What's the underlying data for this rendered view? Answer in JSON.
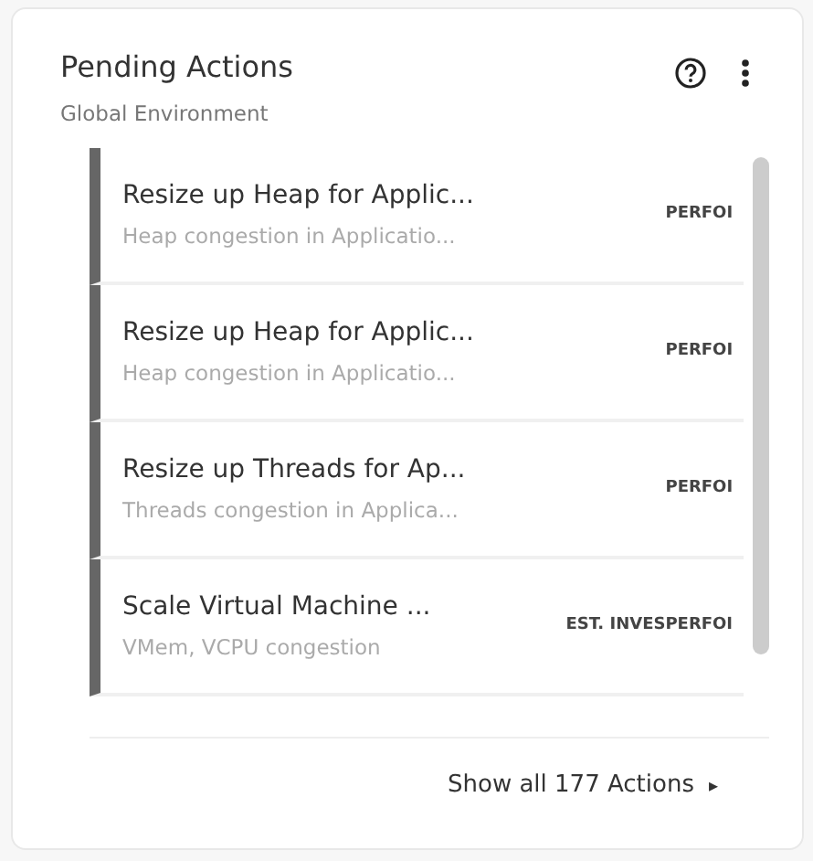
{
  "widget": {
    "title": "Pending Actions",
    "subtitle": "Global Environment"
  },
  "actions": [
    {
      "title": "Resize up Heap for Applic...",
      "detail": "Heap congestion in Applicatio...",
      "tag": "PERFOI"
    },
    {
      "title": "Resize up Heap for Applic...",
      "detail": "Heap congestion in Applicatio...",
      "tag": "PERFOI"
    },
    {
      "title": "Resize up Threads for Ap...",
      "detail": "Threads congestion in Applica...",
      "tag": "PERFOI"
    },
    {
      "title": "Scale Virtual Machine ...",
      "detail": "VMem, VCPU congestion",
      "tag": "EST. INVESPERFOI"
    }
  ],
  "footer": {
    "link": "Show all 177 Actions",
    "arrow": "▸"
  }
}
